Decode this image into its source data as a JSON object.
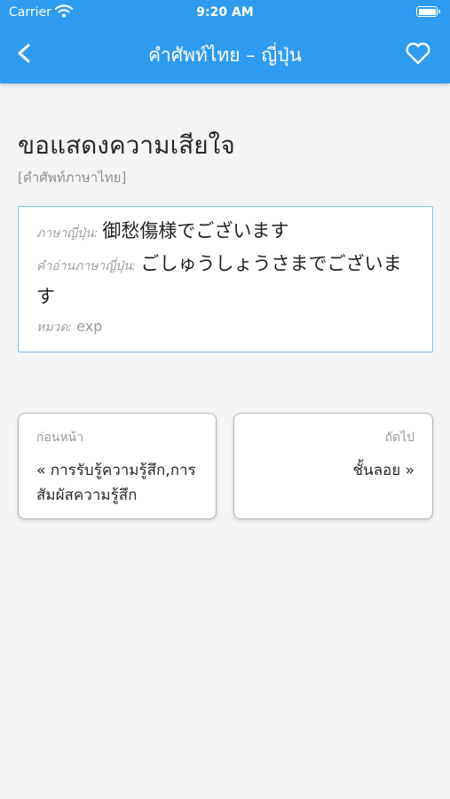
{
  "status": {
    "carrier": "Carrier",
    "time": "9:20 AM"
  },
  "nav": {
    "title": "คำศัพท์ไทย – ญี่ปุ่น"
  },
  "term": {
    "text": "ขอแสดงความเสียใจ",
    "subtitle": "[คำศัพท์ภาษาไทย]"
  },
  "detail": {
    "japanese_label": "ภาษาญี่ปุ่น:",
    "japanese_value": "御愁傷様でございます",
    "reading_label": "คำอ่านภาษาญี่ปุ่น:",
    "reading_value": "ごしゅうしょうさまでございます",
    "category_label": "หมวด:",
    "category_value": "exp"
  },
  "prev": {
    "label": "ก่อนหน้า",
    "value": "« การรับรู้ความรู้สึก,การสัมผัสความรู้สึก"
  },
  "next": {
    "label": "ถัดไป",
    "value": "ชั้นลอย »"
  },
  "icons": {
    "back": "chevron-left-icon",
    "favorite": "heart-outline-icon",
    "wifi": "wifi-icon",
    "battery": "battery-icon"
  },
  "colors": {
    "header": "#2f9bf0",
    "detail_border": "#7cc0f0",
    "background": "#f4f4f4"
  }
}
